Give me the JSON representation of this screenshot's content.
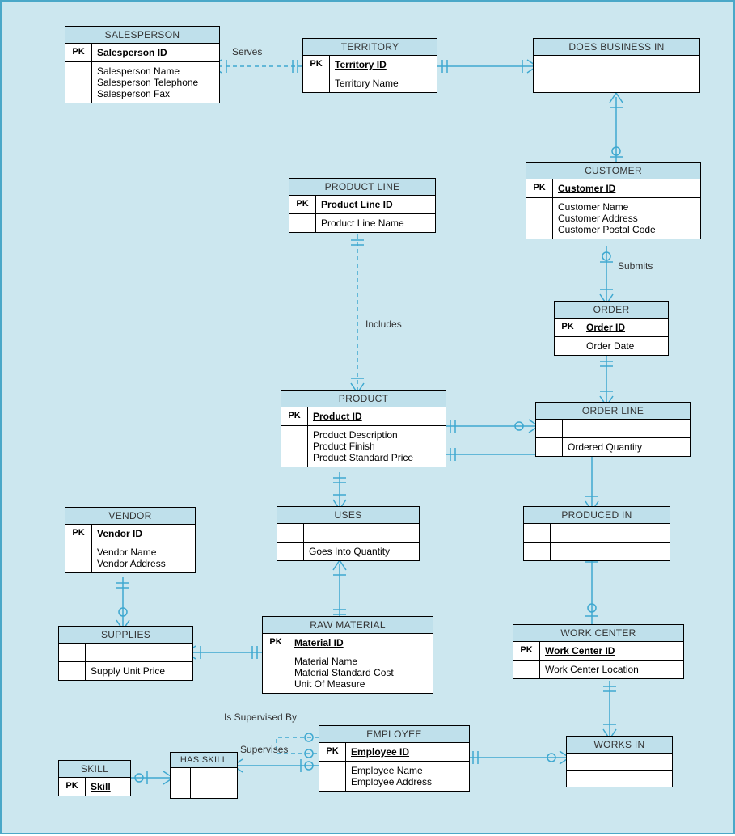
{
  "entities": {
    "salesperson": {
      "title": "SALESPERSON",
      "pk": "Salesperson ID",
      "attrs": [
        "Salesperson Name",
        "Salesperson Telephone",
        "Salesperson Fax"
      ]
    },
    "territory": {
      "title": "TERRITORY",
      "pk": "Territory ID",
      "attrs": [
        "Territory Name"
      ]
    },
    "does_business_in": {
      "title": "DOES BUSINESS IN",
      "pk": "",
      "attrs": [
        ""
      ]
    },
    "customer": {
      "title": "CUSTOMER",
      "pk": "Customer ID",
      "attrs": [
        "Customer Name",
        "Customer Address",
        "Customer Postal Code"
      ]
    },
    "product_line": {
      "title": "PRODUCT LINE",
      "pk": "Product Line ID",
      "attrs": [
        "Product Line Name"
      ]
    },
    "order": {
      "title": "ORDER",
      "pk": "Order ID",
      "attrs": [
        "Order Date"
      ]
    },
    "product": {
      "title": "PRODUCT",
      "pk": "Product ID",
      "attrs": [
        "Product Description",
        "Product Finish",
        "Product Standard Price"
      ]
    },
    "order_line": {
      "title": "ORDER LINE",
      "pk": "",
      "attrs": [
        "Ordered Quantity"
      ]
    },
    "vendor": {
      "title": "VENDOR",
      "pk": "Vendor ID",
      "attrs": [
        "Vendor Name",
        "Vendor Address"
      ]
    },
    "uses": {
      "title": "USES",
      "pk": "",
      "attrs": [
        "Goes Into Quantity"
      ]
    },
    "produced_in": {
      "title": "PRODUCED IN",
      "pk": "",
      "attrs": [
        ""
      ]
    },
    "supplies": {
      "title": "SUPPLIES",
      "pk": "",
      "attrs": [
        "Supply Unit Price"
      ]
    },
    "raw_material": {
      "title": "RAW MATERIAL",
      "pk": "Material ID",
      "attrs": [
        "Material Name",
        "Material Standard Cost",
        "Unit Of Measure"
      ]
    },
    "work_center": {
      "title": "WORK CENTER",
      "pk": "Work Center ID",
      "attrs": [
        "Work Center Location"
      ]
    },
    "employee": {
      "title": "EMPLOYEE",
      "pk": "Employee ID",
      "attrs": [
        "Employee Name",
        "Employee Address"
      ]
    },
    "skill": {
      "title": "SKILL",
      "pk": "Skill",
      "attrs": []
    },
    "has_skill": {
      "title": "HAS SKILL",
      "pk": "",
      "attrs": [
        ""
      ]
    },
    "works_in": {
      "title": "WORKS IN",
      "pk": "",
      "attrs": [
        ""
      ]
    }
  },
  "labels": {
    "serves": "Serves",
    "includes": "Includes",
    "submits": "Submits",
    "is_supervised_by": "Is Supervised By",
    "supervises": "Supervises",
    "pk": "PK"
  },
  "relationships": [
    {
      "from": "SALESPERSON",
      "to": "TERRITORY",
      "label": "Serves",
      "style": "dashed"
    },
    {
      "from": "TERRITORY",
      "to": "DOES BUSINESS IN",
      "style": "solid"
    },
    {
      "from": "DOES BUSINESS IN",
      "to": "CUSTOMER",
      "style": "solid"
    },
    {
      "from": "CUSTOMER",
      "to": "ORDER",
      "label": "Submits",
      "style": "solid"
    },
    {
      "from": "PRODUCT LINE",
      "to": "PRODUCT",
      "label": "Includes",
      "style": "dashed"
    },
    {
      "from": "PRODUCT",
      "to": "ORDER LINE",
      "style": "solid"
    },
    {
      "from": "ORDER",
      "to": "ORDER LINE",
      "style": "solid"
    },
    {
      "from": "PRODUCT",
      "to": "USES",
      "style": "solid"
    },
    {
      "from": "USES",
      "to": "RAW MATERIAL",
      "style": "solid"
    },
    {
      "from": "PRODUCT",
      "to": "PRODUCED IN",
      "style": "solid"
    },
    {
      "from": "PRODUCED IN",
      "to": "WORK CENTER",
      "style": "solid"
    },
    {
      "from": "VENDOR",
      "to": "SUPPLIES",
      "style": "solid"
    },
    {
      "from": "SUPPLIES",
      "to": "RAW MATERIAL",
      "style": "solid"
    },
    {
      "from": "WORK CENTER",
      "to": "WORKS IN",
      "style": "solid"
    },
    {
      "from": "EMPLOYEE",
      "to": "WORKS IN",
      "style": "solid"
    },
    {
      "from": "EMPLOYEE",
      "to": "HAS SKILL",
      "style": "solid"
    },
    {
      "from": "SKILL",
      "to": "HAS SKILL",
      "style": "solid"
    },
    {
      "from": "EMPLOYEE",
      "to": "EMPLOYEE",
      "label": "Is Supervised By / Supervises",
      "style": "dashed"
    }
  ]
}
